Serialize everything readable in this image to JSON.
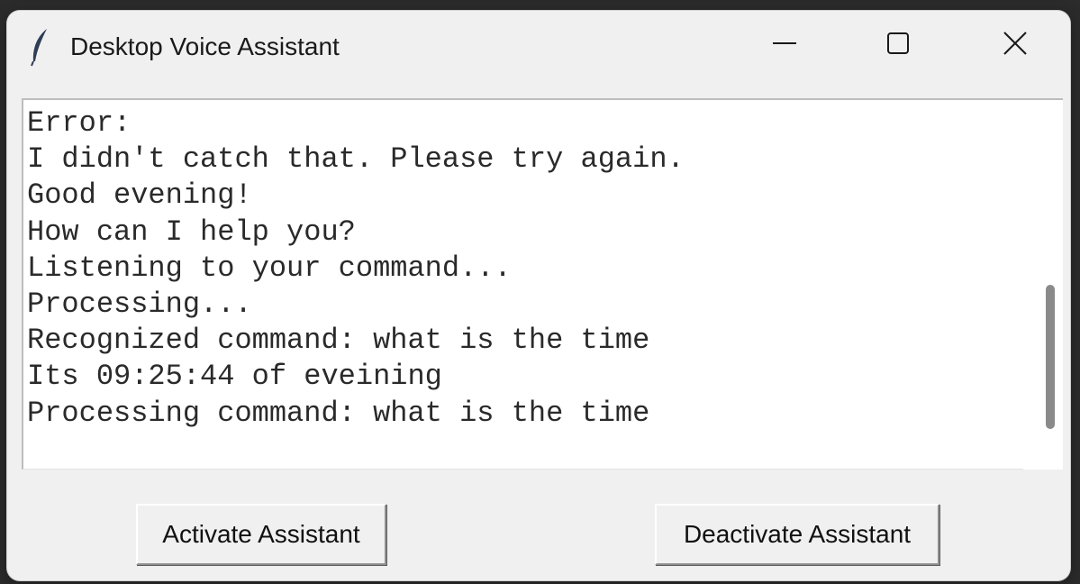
{
  "window": {
    "title": "Desktop Voice Assistant",
    "icon": "feather-icon",
    "controls": {
      "minimize": "minimize-icon",
      "maximize": "maximize-icon",
      "close": "close-icon"
    }
  },
  "output": {
    "lines": [
      "Error:",
      "I didn't catch that. Please try again.",
      "Good evening!",
      "How can I help you?",
      "Listening to your command...",
      "Processing...",
      "Recognized command: what is the time",
      "Its 09:25:44 of eveining",
      "Processing command: what is the time"
    ]
  },
  "buttons": {
    "activate_label": "Activate Assistant",
    "deactivate_label": "Deactivate Assistant"
  }
}
